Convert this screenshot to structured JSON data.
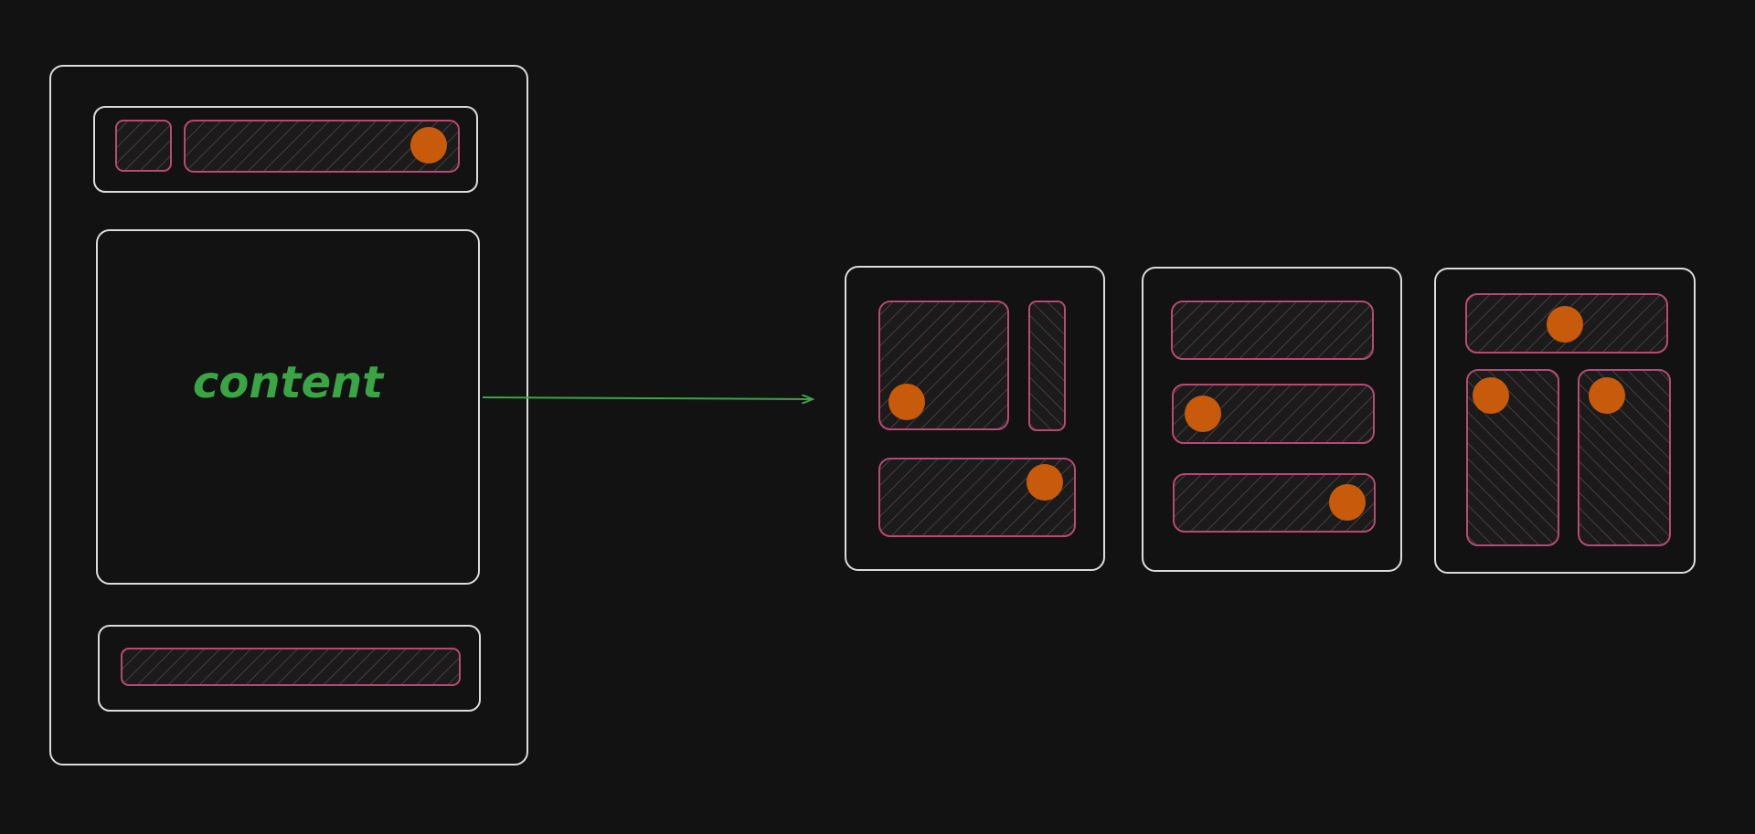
{
  "diagram": {
    "content_label": "content",
    "colors": {
      "background": "#121212",
      "frame_stroke": "#dcdcdc",
      "block_stroke": "#b74a73",
      "dot_fill": "#c75b0b",
      "accent_green": "#3aa545"
    }
  }
}
